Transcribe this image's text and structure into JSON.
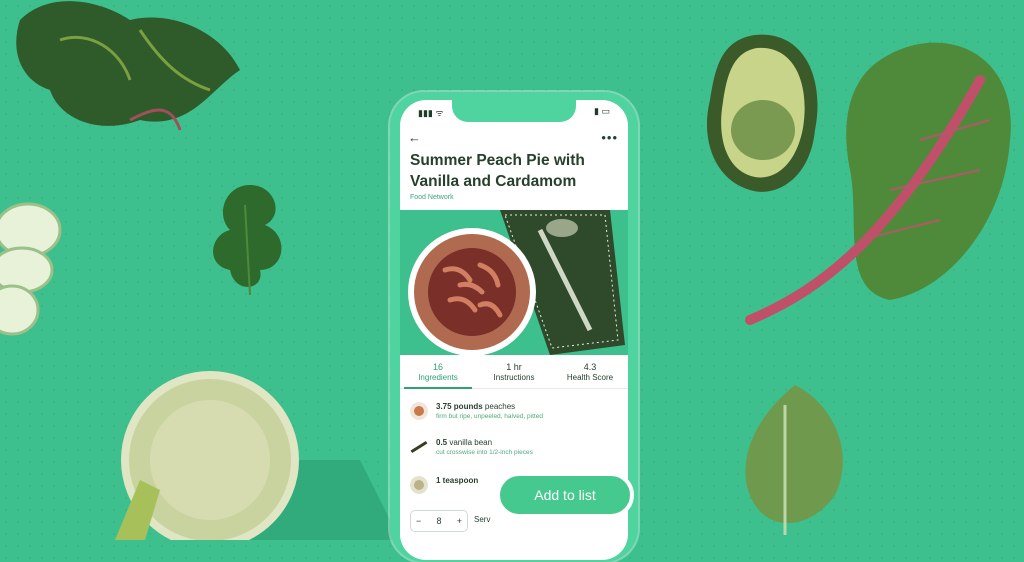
{
  "status_bar": {
    "left": "▮▮▮ ᯤ",
    "right": "▮ ▭"
  },
  "recipe": {
    "title": "Summer Peach Pie with Vanilla and Cardamom",
    "source": "Food Network"
  },
  "stats": [
    {
      "value": "16",
      "label": "Ingredients",
      "active": true
    },
    {
      "value": "1 hr",
      "label": "Instructions",
      "active": false
    },
    {
      "value": "4.3",
      "label": "Health Score",
      "active": false
    }
  ],
  "ingredients": [
    {
      "amount": "3.75 pounds",
      "name": "peaches",
      "note": "firm but ripe, unpeeled, halved, pitted"
    },
    {
      "amount": "0.5",
      "name": "vanilla bean",
      "note": "cut crosswise into 1/2-inch pieces"
    },
    {
      "amount": "1 teaspoon",
      "name": "",
      "note": ""
    }
  ],
  "servings": {
    "minus": "−",
    "value": "8",
    "plus": "+",
    "label": "Serv"
  },
  "cta": {
    "label": "Add to list"
  },
  "icons": {
    "back": "←",
    "more": "•••"
  },
  "colors": {
    "background": "#3ec08e",
    "accent": "#2fa36e",
    "button": "#46c98f"
  }
}
